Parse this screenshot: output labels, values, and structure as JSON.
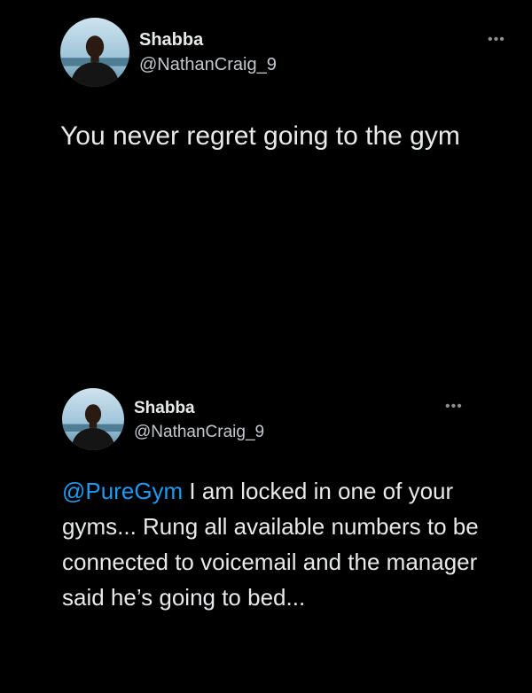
{
  "colors": {
    "background": "#000000",
    "text": "#e7e9ea",
    "secondary_text": "#c4c8cc",
    "mention": "#1d9bf0"
  },
  "tweets": [
    {
      "display_name": "Shabba",
      "handle": "@NathanCraig_9",
      "more_icon": "more-horizontal-icon",
      "more_glyph": "•••",
      "text": "You never regret going to the gym"
    },
    {
      "display_name": "Shabba",
      "handle": "@NathanCraig_9",
      "more_icon": "more-horizontal-icon",
      "more_glyph": "•••",
      "mention": "@PureGym",
      "text": " I am locked in one of your gyms... Rung all available numbers to be connected to voicemail and the manager said he’s going to bed..."
    }
  ]
}
